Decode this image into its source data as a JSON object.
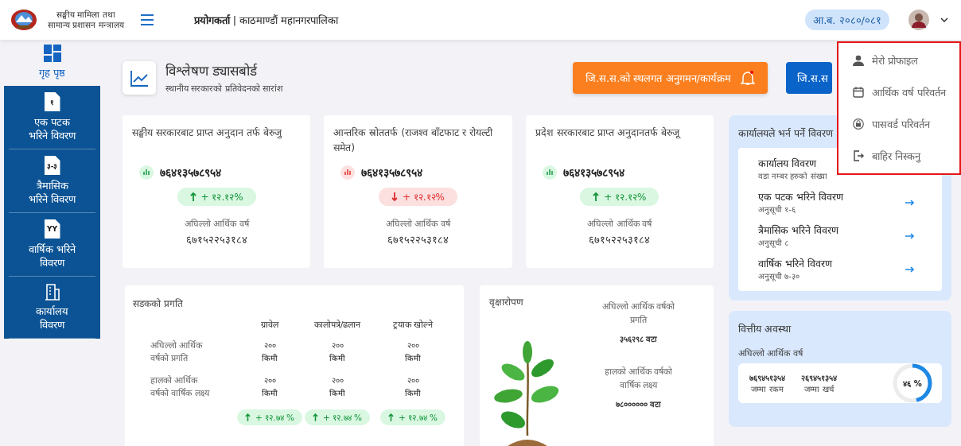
{
  "header": {
    "org_lines": [
      "सङ्घीय मामिला तथा",
      "सामान्य प्रशासन मन्त्रालय"
    ],
    "user_line": "**प्रयोगकर्ता** | काठमाण्डौं महानगरपालिका",
    "fiscal_year": "आ.ब. २०८०/०८१"
  },
  "sidebar": {
    "items": [
      {
        "kind": "dashboard",
        "label": "गृह पृष्ठ",
        "selected": true
      },
      {
        "kind": "doc",
        "icon_text": "१",
        "label": "एक पटक भरिने विवरण",
        "selected": false
      },
      {
        "kind": "doc",
        "icon_text": "३-३",
        "label": "त्रैमासिक भरिने विवरण",
        "selected": false
      },
      {
        "kind": "doc",
        "icon_text": "YY",
        "label": "वार्षिक भरिने विवरण",
        "selected": false
      },
      {
        "kind": "building",
        "label": "कार्यालय विवरण",
        "selected": false
      }
    ]
  },
  "dashboard": {
    "title": "विश्लेषण ड्यासबोर्ड",
    "subtitle": "स्थानीय सरकारको प्रतिवेदनको सारांश",
    "buttons": [
      {
        "kind": "orange",
        "label": "जि.स.स.को स्थलगत अनुगमन/कार्यक्रम"
      },
      {
        "kind": "blue",
        "label": "जि.स.स"
      }
    ]
  },
  "stats": [
    {
      "title": "सङ्घीय  सरकारबाट प्राप्त अनुदान तर्फ बेरुजु",
      "value": "७६४१३५७८९५४",
      "rising": true,
      "change": "+ १२.१२%",
      "prev_label": "अघिल्लो आर्थिक वर्ष",
      "prev_value": "६७१५२२५३१८४"
    },
    {
      "title": "आन्तरिक स्रोततर्फ (राजश्व बाँटफाट र रोयल्टी समेत)",
      "value": "७६४१३५७८९५४",
      "rising": false,
      "change": "+ १२.१२%",
      "prev_label": "अघिल्लो आर्थिक वर्ष",
      "prev_value": "६७१५२२५३१८४"
    },
    {
      "title": "प्रदेश सरकारबाट प्राप्त अनुदानतर्फ बेरुजू",
      "value": "७६४१३५७८९५४",
      "rising": true,
      "change": "+ १२.१२%",
      "prev_label": "अघिल्लो आर्थिक वर्ष",
      "prev_value": "६७१५२२५३१८४"
    }
  ],
  "office_panel": {
    "title": "कार्यालयले भर्न पर्ने विवरण",
    "items": [
      {
        "title": "कार्यालय विवरण",
        "subtitle": "वडा नम्बर हरुको संख्या"
      },
      {
        "title": "एक पटक भरिने विवरण",
        "subtitle": "अनुसूची १-६"
      },
      {
        "title": "त्रैमासिक भरिने विवरण",
        "subtitle": "अनुसूची ८"
      },
      {
        "title": "वार्षिक भरिने विवरण",
        "subtitle": "अनुसूची ७-३०"
      }
    ]
  },
  "road": {
    "title": "सडकको प्रगति",
    "columns": [
      "ग्रावेल",
      "कालोपत्रे/ढलान",
      "ट्रयाक खोल्ने"
    ],
    "rows": [
      {
        "label": "अघिल्लो आर्थिक वर्षको प्रगति",
        "values": [
          [
            "२००",
            "किमी"
          ],
          [
            "२००",
            "किमी"
          ],
          [
            "२००",
            "किमी"
          ]
        ]
      },
      {
        "label": "हालको आर्थिक वर्षको वार्षिक लक्ष्य",
        "values": [
          [
            "२००",
            "किमी"
          ],
          [
            "२००",
            "किमी"
          ],
          [
            "२००",
            "किमी"
          ]
        ]
      }
    ],
    "changes": [
      "+ १२.७४ %",
      "+ १२.७४ %",
      "+ १२.७४ %"
    ]
  },
  "tree": {
    "title": "वृक्षारोपण",
    "prev_label": "अघिल्लो आर्थिक वर्षको प्रगति",
    "prev_value": "३५६२९८  वटा",
    "target_label": "हालको आर्थिक वर्षको वार्षिक लक्ष्य",
    "target_value": "७८०००००० वटा"
  },
  "finance": {
    "title": "वित्तीय अवस्था",
    "period_label": "अघिल्लो आर्थिक वर्ष",
    "total": "७६९४५१३५४",
    "total_label": "जम्मा रकम",
    "spent": "२६९४५१३५४",
    "spent_label": "जम्मा खर्च",
    "percent": "४६ %",
    "level": 0.46
  },
  "user_menu": {
    "items": [
      {
        "kind": "profile",
        "label": "मेरो प्रोफाइल"
      },
      {
        "kind": "calendar",
        "label": "आर्थिक वर्ष परिवर्तन"
      },
      {
        "kind": "lock",
        "label": "पासवर्ड परिवर्तन"
      },
      {
        "kind": "logout",
        "label": "बाहिर निस्कनु"
      }
    ]
  }
}
